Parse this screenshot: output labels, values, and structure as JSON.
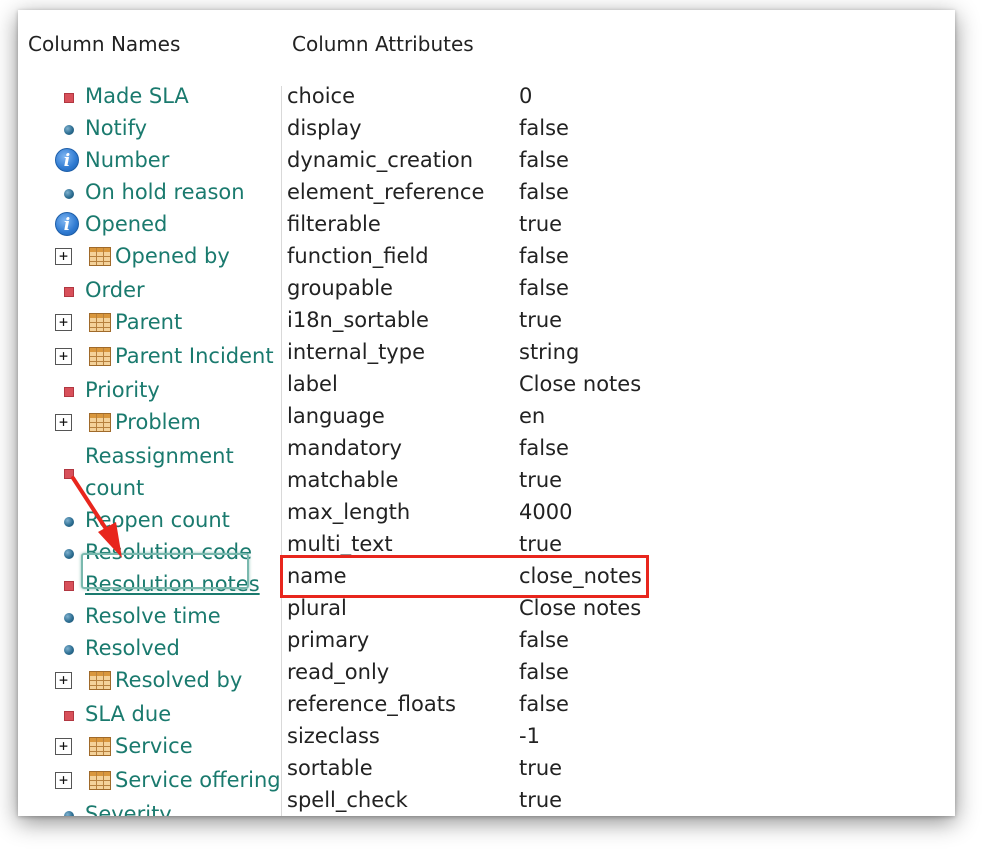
{
  "headers": {
    "names": "Column Names",
    "attributes": "Column Attributes"
  },
  "columns": [
    {
      "label": "Made SLA",
      "icon": "red-square-icon",
      "expand": false
    },
    {
      "label": "Notify",
      "icon": "blue-dot-icon",
      "expand": false
    },
    {
      "label": "Number",
      "icon": "info-icon",
      "expand": false
    },
    {
      "label": "On hold reason",
      "icon": "blue-dot-icon",
      "expand": false
    },
    {
      "label": "Opened",
      "icon": "info-icon",
      "expand": false
    },
    {
      "label": "Opened by",
      "icon": "table-icon",
      "expand": true
    },
    {
      "label": "Order",
      "icon": "red-square-icon",
      "expand": false
    },
    {
      "label": "Parent",
      "icon": "table-icon",
      "expand": true
    },
    {
      "label": "Parent Incident",
      "icon": "table-icon",
      "expand": true
    },
    {
      "label": "Priority",
      "icon": "red-square-icon",
      "expand": false
    },
    {
      "label": "Problem",
      "icon": "table-icon",
      "expand": true
    },
    {
      "label": "Reassignment count",
      "icon": "red-square-icon",
      "expand": false
    },
    {
      "label": "Reopen count",
      "icon": "blue-dot-icon",
      "expand": false
    },
    {
      "label": "Resolution code",
      "icon": "blue-dot-icon",
      "expand": false
    },
    {
      "label": "Resolution notes",
      "icon": "red-square-icon",
      "expand": false,
      "selected": true
    },
    {
      "label": "Resolve time",
      "icon": "blue-dot-icon",
      "expand": false
    },
    {
      "label": "Resolved",
      "icon": "blue-dot-icon",
      "expand": false
    },
    {
      "label": "Resolved by",
      "icon": "table-icon",
      "expand": true
    },
    {
      "label": "SLA due",
      "icon": "red-square-icon",
      "expand": false
    },
    {
      "label": "Service",
      "icon": "table-icon",
      "expand": true
    },
    {
      "label": "Service offering",
      "icon": "table-icon",
      "expand": true
    },
    {
      "label": "Severity",
      "icon": "blue-dot-icon",
      "expand": false
    }
  ],
  "attributes": [
    {
      "key": "choice",
      "value": "0"
    },
    {
      "key": "display",
      "value": "false"
    },
    {
      "key": "dynamic_creation",
      "value": "false"
    },
    {
      "key": "element_reference",
      "value": "false"
    },
    {
      "key": "filterable",
      "value": "true"
    },
    {
      "key": "function_field",
      "value": "false"
    },
    {
      "key": "groupable",
      "value": "false"
    },
    {
      "key": "i18n_sortable",
      "value": "true"
    },
    {
      "key": "internal_type",
      "value": "string"
    },
    {
      "key": "label",
      "value": "Close notes"
    },
    {
      "key": "language",
      "value": "en"
    },
    {
      "key": "mandatory",
      "value": "false"
    },
    {
      "key": "matchable",
      "value": "true"
    },
    {
      "key": "max_length",
      "value": "4000"
    },
    {
      "key": "multi_text",
      "value": "true"
    },
    {
      "key": "name",
      "value": "close_notes",
      "highlighted": true
    },
    {
      "key": "plural",
      "value": "Close notes"
    },
    {
      "key": "primary",
      "value": "false"
    },
    {
      "key": "read_only",
      "value": "false"
    },
    {
      "key": "reference_floats",
      "value": "false"
    },
    {
      "key": "sizeclass",
      "value": "-1"
    },
    {
      "key": "sortable",
      "value": "true"
    },
    {
      "key": "spell_check",
      "value": "true"
    }
  ],
  "colors": {
    "link": "#1a7a6e",
    "highlight": "#e8261d",
    "selection": "#7ab9ae"
  }
}
